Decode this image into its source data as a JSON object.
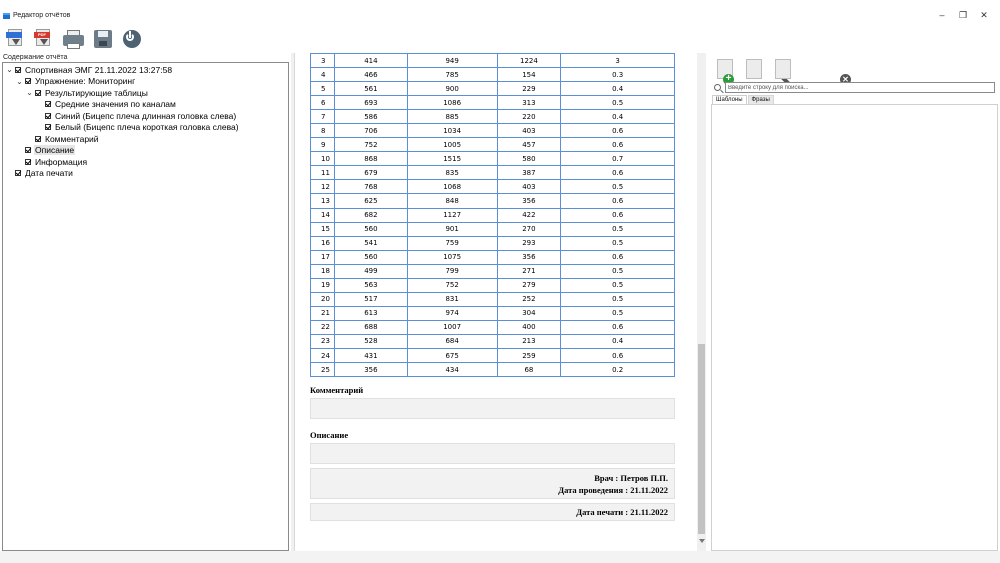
{
  "window": {
    "title": "Редактор отчётов",
    "minimize_glyph": "–",
    "restore_glyph": "❐",
    "close_glyph": "✕"
  },
  "toolbar": {
    "pdf_export_tag_1": "PDF",
    "pdf_export_tag_2": "PDF",
    "icons": [
      "export-blue-icon",
      "export-pdf-icon",
      "printer-icon",
      "floppy-save-icon",
      "power-icon"
    ]
  },
  "left_panel": {
    "header": "Содержание отчёта",
    "tree": [
      {
        "label": "Спортивная ЭМГ 21.11.2022 13:27:58",
        "level": 0,
        "expander": "⌄",
        "checked": true
      },
      {
        "label": "Упражнение: Мониторинг",
        "level": 1,
        "expander": "⌄",
        "checked": true
      },
      {
        "label": "Результирующие таблицы",
        "level": 2,
        "expander": "⌄",
        "checked": true
      },
      {
        "label": "Средние значения по каналам",
        "level": 3,
        "expander": "",
        "checked": true
      },
      {
        "label": "Синий (Бицепс плеча длинная головка слева)",
        "level": 3,
        "expander": "",
        "checked": true
      },
      {
        "label": "Белый (Бицепс плеча короткая головка слева)",
        "level": 3,
        "expander": "",
        "checked": true
      },
      {
        "label": "Комментарий",
        "level": 2,
        "expander": "",
        "checked": true
      },
      {
        "label": "Описание",
        "level": 1,
        "expander": "",
        "checked": true,
        "selected": true
      },
      {
        "label": "Информация",
        "level": 1,
        "expander": "",
        "checked": true
      },
      {
        "label": "Дата печати",
        "level": 0,
        "expander": "",
        "checked": true
      }
    ]
  },
  "report": {
    "rows": [
      [
        "3",
        "414",
        "949",
        "1224",
        "3"
      ],
      [
        "4",
        "466",
        "785",
        "154",
        "0.3"
      ],
      [
        "5",
        "561",
        "900",
        "229",
        "0.4"
      ],
      [
        "6",
        "693",
        "1086",
        "313",
        "0.5"
      ],
      [
        "7",
        "586",
        "885",
        "220",
        "0.4"
      ],
      [
        "8",
        "706",
        "1034",
        "403",
        "0.6"
      ],
      [
        "9",
        "752",
        "1005",
        "457",
        "0.6"
      ],
      [
        "10",
        "868",
        "1515",
        "580",
        "0.7"
      ],
      [
        "11",
        "679",
        "835",
        "387",
        "0.6"
      ],
      [
        "12",
        "768",
        "1068",
        "403",
        "0.5"
      ],
      [
        "13",
        "625",
        "848",
        "356",
        "0.6"
      ],
      [
        "14",
        "682",
        "1127",
        "422",
        "0.6"
      ],
      [
        "15",
        "560",
        "901",
        "270",
        "0.5"
      ],
      [
        "16",
        "541",
        "759",
        "293",
        "0.5"
      ],
      [
        "17",
        "560",
        "1075",
        "356",
        "0.6"
      ],
      [
        "18",
        "499",
        "799",
        "271",
        "0.5"
      ],
      [
        "19",
        "563",
        "752",
        "279",
        "0.5"
      ],
      [
        "20",
        "517",
        "831",
        "252",
        "0.5"
      ],
      [
        "21",
        "613",
        "974",
        "304",
        "0.5"
      ],
      [
        "22",
        "688",
        "1007",
        "400",
        "0.6"
      ],
      [
        "23",
        "528",
        "684",
        "213",
        "0.4"
      ],
      [
        "24",
        "431",
        "675",
        "259",
        "0.6"
      ],
      [
        "25",
        "356",
        "434",
        "68",
        "0.2"
      ]
    ],
    "comment_title": "Комментарий",
    "description_title": "Описание",
    "doctor": "Врач : Петров П.П.",
    "date_conducted": "Дата проведения : 21.11.2022",
    "print_date": "Дата печати : 21.11.2022"
  },
  "right_panel": {
    "search_placeholder": "Введите строку для поиска...",
    "add_glyph": "+",
    "delete_glyph": "✕",
    "tabs": [
      "Шаблоны",
      "Фразы"
    ]
  },
  "colors": {
    "table_border": "#5b8fd6",
    "grey_box": "#f2f2f2",
    "add_green": "#2e9b3a"
  }
}
